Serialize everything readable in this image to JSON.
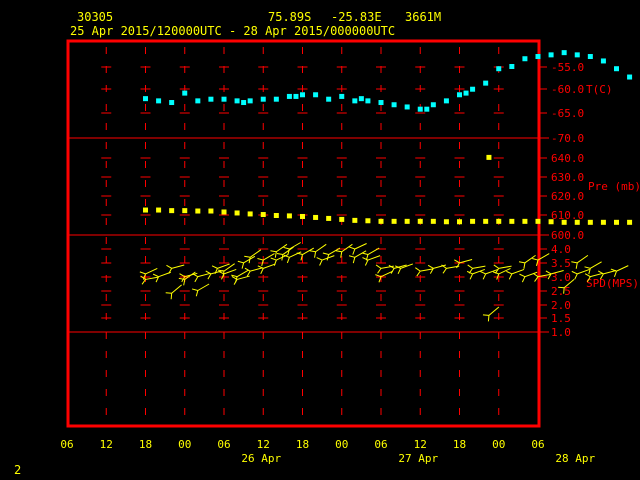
{
  "header": {
    "station": "30305",
    "lat": "75.89S",
    "lon": "-25.83E",
    "elev": "3661M",
    "period": "25 Apr 2015/120000UTC - 28 Apr 2015/000000UTC"
  },
  "footer": {
    "page_number": "2"
  },
  "colors": {
    "frame": "#ff0000",
    "text": "#ffff00",
    "temp": "#00ffff",
    "pres": "#ffff00",
    "wind": "#ffff00"
  },
  "chart_data": {
    "type": "scatter",
    "x_unit": "hours since 25 Apr 06 UTC",
    "x_ticks": [
      "06",
      "12",
      "18",
      "00",
      "06",
      "12",
      "18",
      "00",
      "06",
      "12",
      "18",
      "00",
      "06"
    ],
    "date_labels": [
      "26 Apr",
      "27 Apr",
      "28 Apr"
    ],
    "panels": [
      {
        "name": "temperature",
        "label": "T(C)",
        "ticks": [
          "-55.0",
          "-60.0",
          "-65.0",
          "-70.0"
        ],
        "ylim": [
          -70,
          -52.5
        ],
        "x": [
          12,
          14,
          16,
          18,
          20,
          22,
          24,
          26,
          27,
          28,
          30,
          32,
          34,
          35,
          36,
          38,
          40,
          42,
          44,
          45,
          46,
          48,
          50,
          52,
          54,
          55,
          56,
          58,
          60,
          61,
          62,
          64,
          66,
          68,
          70,
          72,
          74,
          76,
          78,
          80,
          82,
          84,
          86,
          88
        ],
        "values": [
          -62.9,
          -63.3,
          -63.6,
          -61.9,
          -63.3,
          -63.0,
          -63.0,
          -63.3,
          -63.6,
          -63.3,
          -63.0,
          -63.0,
          -62.5,
          -62.5,
          -62.2,
          -62.2,
          -63.0,
          -62.5,
          -63.3,
          -62.9,
          -63.3,
          -63.6,
          -64.0,
          -64.4,
          -64.8,
          -64.8,
          -64.0,
          -63.3,
          -62.2,
          -61.9,
          -61.2,
          -60.1,
          -57.5,
          -57.1,
          -55.7,
          -55.3,
          -55.0,
          -54.6,
          -55.0,
          -55.3,
          -56.1,
          -57.5,
          -59.0,
          -59.0
        ]
      },
      {
        "name": "pressure",
        "label": "Pre (mb)",
        "ticks": [
          "640.0",
          "630.0",
          "620.0",
          "610.0",
          "600.0"
        ],
        "ylim": [
          595,
          645
        ],
        "x": [
          12,
          14,
          16,
          18,
          20,
          22,
          24,
          26,
          28,
          30,
          32,
          34,
          36,
          38,
          40,
          42,
          44,
          46,
          48,
          50,
          52,
          54,
          56,
          58,
          60,
          62,
          64,
          66,
          68,
          70,
          72,
          74,
          76,
          78,
          80,
          82,
          84,
          86,
          88,
          64.5
        ],
        "values": [
          612.8,
          612.8,
          612.5,
          612.5,
          612.3,
          612.3,
          611.8,
          611.3,
          610.8,
          610.5,
          610.0,
          609.8,
          609.5,
          609.0,
          608.5,
          608.0,
          607.5,
          607.3,
          607.0,
          607.0,
          607.0,
          607.0,
          607.0,
          606.8,
          606.8,
          607.0,
          607.0,
          607.0,
          607.0,
          607.0,
          607.0,
          606.8,
          606.5,
          606.5,
          606.5,
          606.5,
          606.5,
          606.5,
          606.5,
          639.8
        ]
      },
      {
        "name": "wind_speed",
        "label": "SPD(MPS)",
        "ticks": [
          "4.0",
          "3.5",
          "3.0",
          "2.5",
          "2.0",
          "1.5",
          "1.0"
        ],
        "ylim": [
          1.0,
          4.0
        ],
        "x": [
          12,
          12,
          14,
          16,
          16,
          18,
          18,
          20,
          20,
          22,
          23,
          24,
          24,
          26,
          26,
          27,
          28,
          28,
          30,
          30,
          32,
          32,
          33,
          34,
          34,
          36,
          38,
          39,
          40,
          42,
          44,
          44,
          46,
          46,
          48,
          48,
          50,
          51,
          54,
          56,
          58,
          60,
          62,
          62,
          64,
          64.5,
          66,
          66,
          68,
          70,
          70,
          72,
          72,
          74,
          76,
          78,
          78,
          80,
          80,
          82,
          84
        ],
        "values": [
          2.9,
          3.1,
          3.0,
          2.4,
          3.3,
          2.9,
          3.0,
          3.0,
          2.5,
          3.1,
          3.3,
          3.1,
          3.2,
          2.9,
          3.0,
          3.5,
          3.2,
          3.7,
          3.6,
          3.3,
          3.9,
          3.6,
          3.8,
          4.0,
          3.7,
          3.8,
          3.9,
          3.6,
          3.8,
          3.9,
          3.7,
          4.0,
          3.6,
          3.8,
          3.3,
          3.0,
          3.3,
          3.3,
          3.2,
          3.3,
          3.3,
          3.5,
          3.3,
          3.1,
          3.1,
          1.6,
          3.1,
          3.3,
          3.1,
          3.0,
          3.5,
          3.6,
          3.0,
          3.1,
          2.6,
          3.1,
          3.5,
          3.3,
          3.0,
          3.1,
          3.2
        ],
        "dir_deg": [
          80,
          65,
          70,
          50,
          75,
          55,
          75,
          75,
          60,
          75,
          70,
          70,
          55,
          75,
          60,
          60,
          75,
          55,
          60,
          70,
          55,
          65,
          55,
          60,
          65,
          60,
          55,
          70,
          60,
          55,
          60,
          65,
          70,
          60,
          80,
          65,
          75,
          70,
          80,
          75,
          80,
          75,
          80,
          70,
          70,
          50,
          65,
          80,
          70,
          70,
          55,
          60,
          80,
          75,
          50,
          70,
          55,
          60,
          75,
          75,
          65
        ]
      }
    ]
  }
}
